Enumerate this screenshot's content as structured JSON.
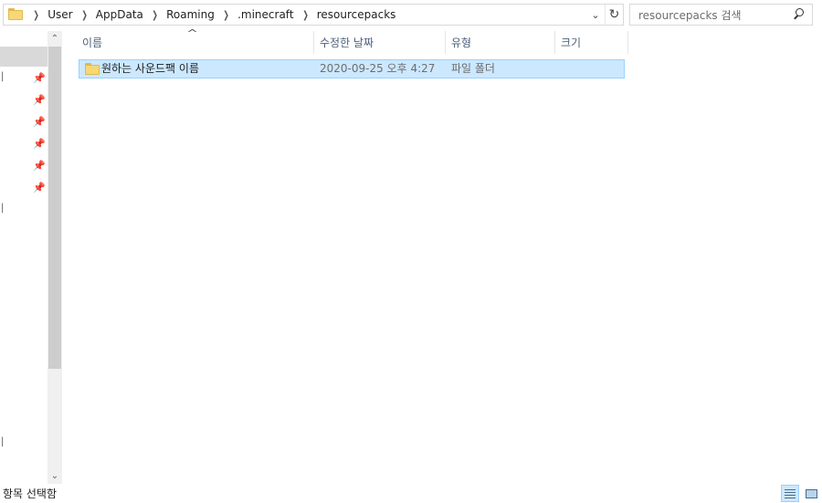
{
  "address_bar": {
    "crumbs": [
      "User",
      "AppData",
      "Roaming",
      ".minecraft",
      "resourcepacks"
    ],
    "dropdown_icon": "chevron-down-icon",
    "refresh_icon": "refresh-icon"
  },
  "search": {
    "placeholder": "resourcepacks 검색"
  },
  "columns": {
    "name": "이름",
    "date_modified": "수정한 날짜",
    "type": "유형",
    "size": "크기"
  },
  "files": [
    {
      "name": "원하는 사운드팩 이름",
      "date_modified": "2020-09-25 오후 4:27",
      "type": "파일 폴더",
      "size": ""
    }
  ],
  "status_bar": {
    "text": "항목 선택함"
  },
  "colors": {
    "selection": "#cce8ff",
    "selection_border": "#99d1ff",
    "header_text": "#4c607a",
    "folder": "#f8d775"
  }
}
